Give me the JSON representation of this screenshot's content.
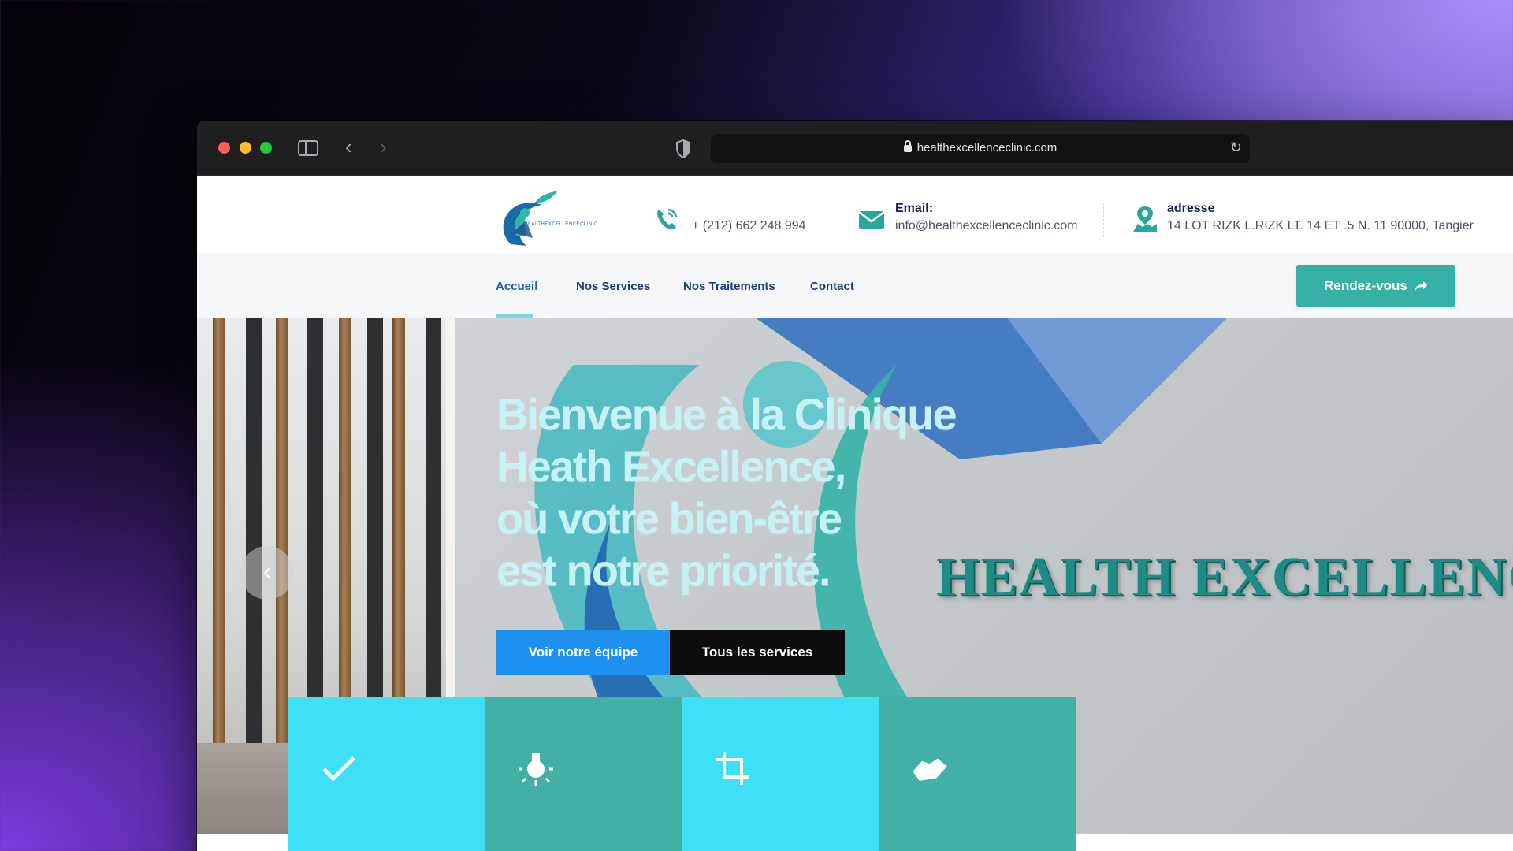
{
  "browser": {
    "url": "healthexcellenceclinic.com"
  },
  "header": {
    "logo_text": "EALTHEXCELLENCECLINIC",
    "phone": {
      "value": "+ (212) 662 248 994"
    },
    "email": {
      "label": "Email:",
      "value": "info@healthexcellenceclinic.com"
    },
    "address": {
      "label": "adresse",
      "value": "14 LOT RIZK L.RIZK LT. 14 ET .5 N. 11 90000, Tangier"
    }
  },
  "nav": {
    "items": [
      {
        "label": "Accueil",
        "active": true
      },
      {
        "label": "Nos Services"
      },
      {
        "label": "Nos Traitements"
      },
      {
        "label": "Contact"
      }
    ],
    "cta_label": "Rendez-vous"
  },
  "hero": {
    "title_lines": [
      "Bienvenue à la Clinique",
      "Heath Excellence,",
      "où votre bien-être",
      "est notre priorité."
    ],
    "wall_text": "HEALTH EXCELLENC",
    "btn_team": "Voir notre équipe",
    "btn_services": "Tous les services"
  },
  "features": [
    {
      "icon": "check-icon",
      "color": "#3fe0f7"
    },
    {
      "icon": "lightbulb-icon",
      "color": "#43b0a5"
    },
    {
      "icon": "crop-icon",
      "color": "#3fe0f7"
    },
    {
      "icon": "handshake-icon",
      "color": "#43b0a5"
    }
  ],
  "colors": {
    "teal": "#37b0a5",
    "blue": "#1e90f0",
    "nav_text": "#1f3b7a"
  }
}
